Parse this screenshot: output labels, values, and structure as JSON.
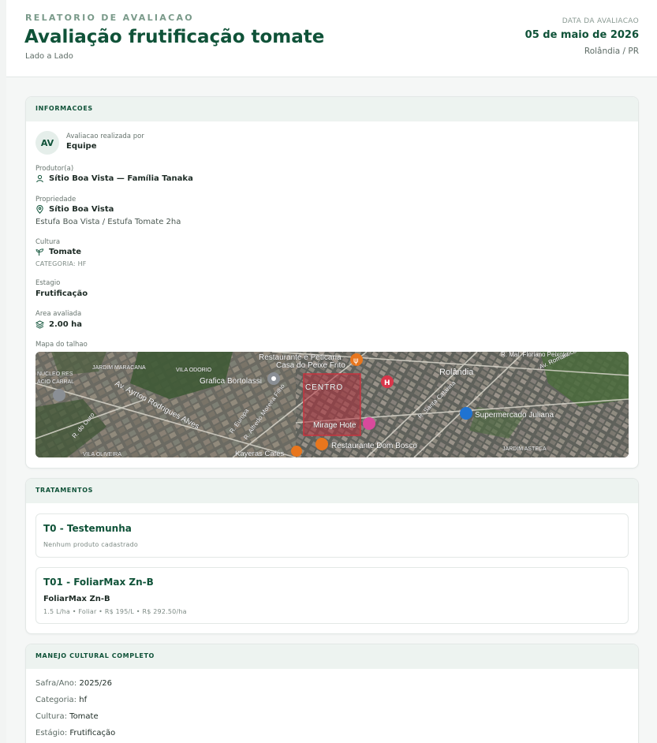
{
  "header": {
    "eyebrow": "RELATORIO DE AVALIACAO",
    "title": "Avaliação frutificação tomate",
    "subtitle": "Lado a Lado",
    "date_label": "DATA DA AVALIACAO",
    "date_value": "05 de maio de 2026",
    "location": "Rolândia / PR"
  },
  "info": {
    "heading": "INFORMACOES",
    "avatar_initials": "AV",
    "evaluated_by_label": "Avaliacao realizada por",
    "evaluated_by": "Equipe",
    "producer_label": "Produtor(a)",
    "producer": "Sítio Boa Vista — Família Tanaka",
    "property_label": "Propriedade",
    "property": "Sítio Boa Vista",
    "property_detail": "Estufa Boa Vista / Estufa Tomate 2ha",
    "crop_label": "Cultura",
    "crop": "Tomate",
    "crop_category": "CATEGORIA: HF",
    "stage_label": "Estagio",
    "stage": "Frutificação",
    "area_label": "Area avaliada",
    "area": "2.00 ha",
    "map_label": "Mapa do talhao",
    "map_labels": {
      "restaurant1": "Restaurante e Peticaria",
      "restaurant1b": "Casa do Peixe Frito",
      "city": "Rolândia",
      "grafica": "Grafica Bortolassi",
      "centro": "CENTRO",
      "ayrton": "Av. Ayrton Rodrigues Alves",
      "supermercado": "Supermercado Juliana",
      "mirage": "Mirage Hote",
      "dombosco": "Restaurante Dom Bosco",
      "kayeras": "Kayeras Cafés",
      "vila_odorio": "VILA ODORIO",
      "jardim_maracana": "JARDIM MARACANA",
      "vila_oliveira": "VILA OLIVEIRA",
      "jardim_asteca": "JARDIM ASTECA",
      "nucleo": "NUCLEO RES",
      "acio_cabral": "ACIO CABRAL",
      "europa": "R. Europa",
      "moreira": "R. Alfredo Moreira Filho",
      "santa_catarina": "R. Santa Catarina",
      "cabral": "R. Gabriel Leal",
      "floriano": "R. Mal. Floriano Peixoto",
      "oro": "R. do Ouro",
      "rio": "Av. Ro",
      "colone": "R. Colon",
      "roman": "Av. Romantico"
    }
  },
  "treatments": {
    "heading": "TRATAMENTOS",
    "items": [
      {
        "title": "T0 - Testemunha",
        "empty": "Nenhum produto cadastrado"
      },
      {
        "title": "T01 - FoliarMax Zn-B",
        "product": "FoliarMax Zn-B",
        "detail": "1.5 L/ha • Foliar • R$ 195/L • R$ 292.50/ha"
      }
    ]
  },
  "management": {
    "heading": "MANEJO CULTURAL COMPLETO",
    "rows": [
      {
        "k": "Safra/Ano:",
        "v": "2025/26"
      },
      {
        "k": "Categoria:",
        "v": "hf"
      },
      {
        "k": "Cultura:",
        "v": "Tomate"
      },
      {
        "k": "Estágio:",
        "v": "Frutificação"
      }
    ]
  },
  "colors": {
    "brand": "#0f5238",
    "accent_bg": "#edf3f0",
    "muted": "#7a9a8a"
  },
  "icons": {
    "producer": "user-icon",
    "property": "map-pin-icon",
    "crop": "sprout-icon",
    "area": "layers-icon"
  }
}
